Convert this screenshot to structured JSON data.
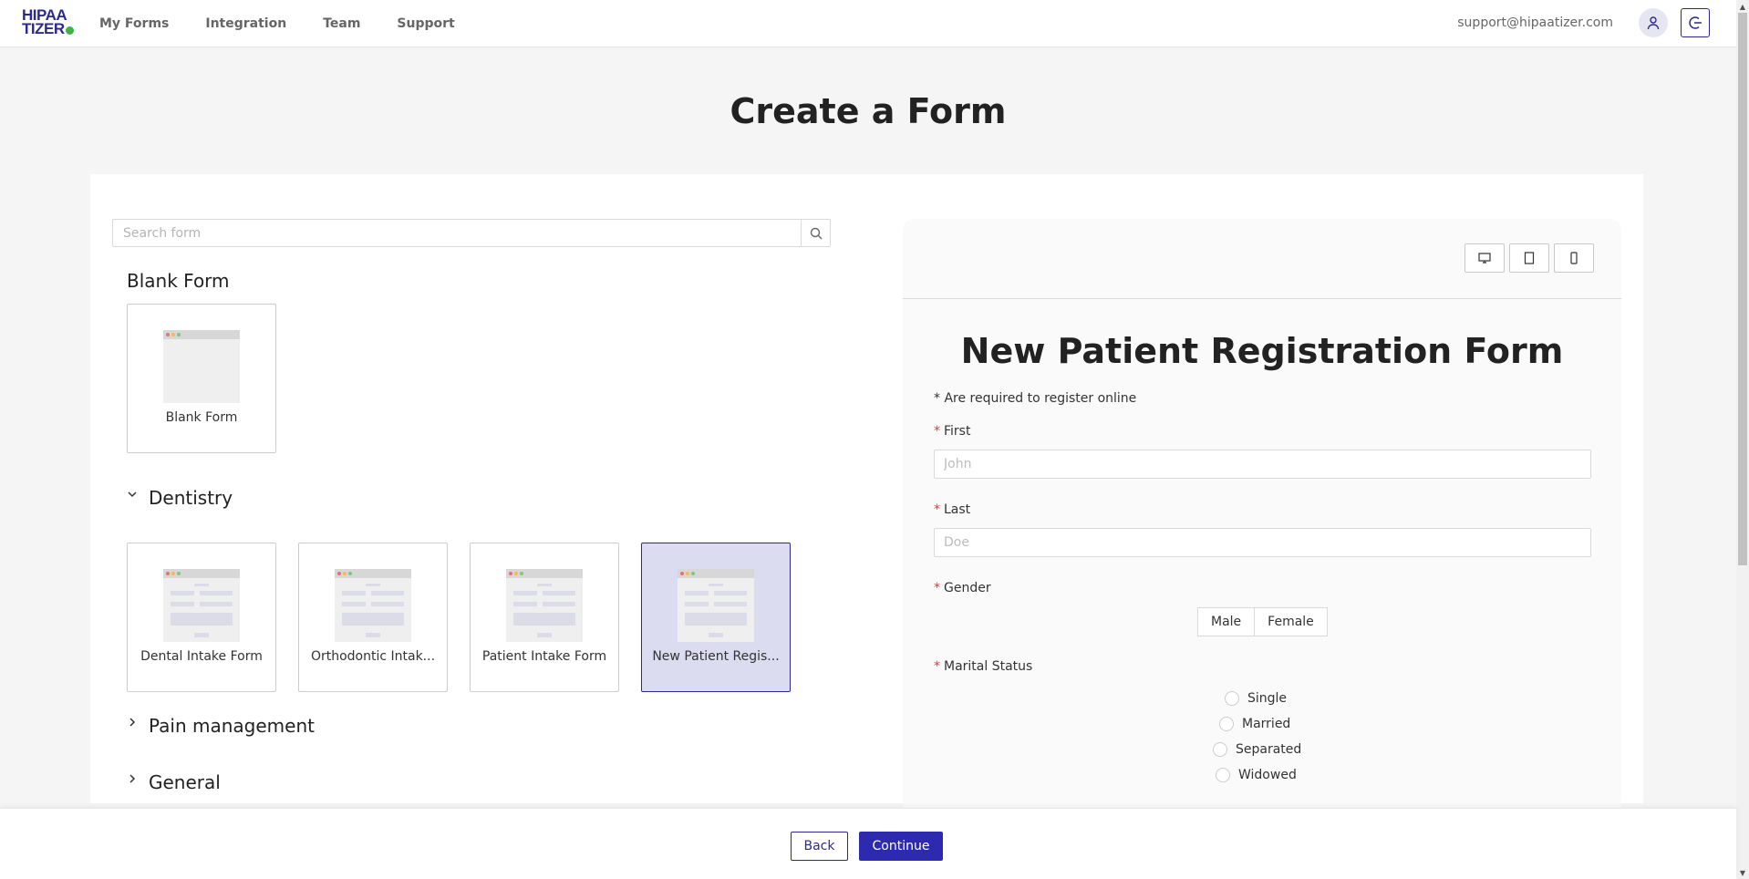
{
  "brand": {
    "logo_line1": "HIPAA",
    "logo_line2": "TIZER"
  },
  "nav": {
    "items": [
      "My Forms",
      "Integration",
      "Team",
      "Support"
    ]
  },
  "account": {
    "email": "support@hipaatizer.com"
  },
  "page": {
    "title": "Create a Form"
  },
  "search": {
    "placeholder": "Search form",
    "value": ""
  },
  "sections": {
    "blank": {
      "title": "Blank Form",
      "tile_label": "Blank Form"
    },
    "dentistry": {
      "title": "Dentistry",
      "tiles": [
        "Dental Intake Form",
        "Orthodontic Intak...",
        "Patient Intake Form",
        "New Patient Regis..."
      ]
    },
    "pain": {
      "title": "Pain management"
    },
    "general": {
      "title": "General"
    }
  },
  "preview": {
    "title": "New Patient Registration Form",
    "note": "* Are required to register online",
    "required_mark": "*",
    "fields": {
      "first": {
        "label": "First",
        "placeholder": "John"
      },
      "last": {
        "label": "Last",
        "placeholder": "Doe"
      },
      "gender": {
        "label": "Gender",
        "options": [
          "Male",
          "Female"
        ]
      },
      "marital": {
        "label": "Marital Status",
        "options": [
          "Single",
          "Married",
          "Separated",
          "Widowed"
        ]
      }
    }
  },
  "footer": {
    "back_label": "Back",
    "continue_label": "Continue"
  },
  "colors": {
    "brand": "#2d2a8f",
    "accent_green": "#3bb54a",
    "required": "#e53935",
    "selected_tile": "#dcdcf0"
  }
}
